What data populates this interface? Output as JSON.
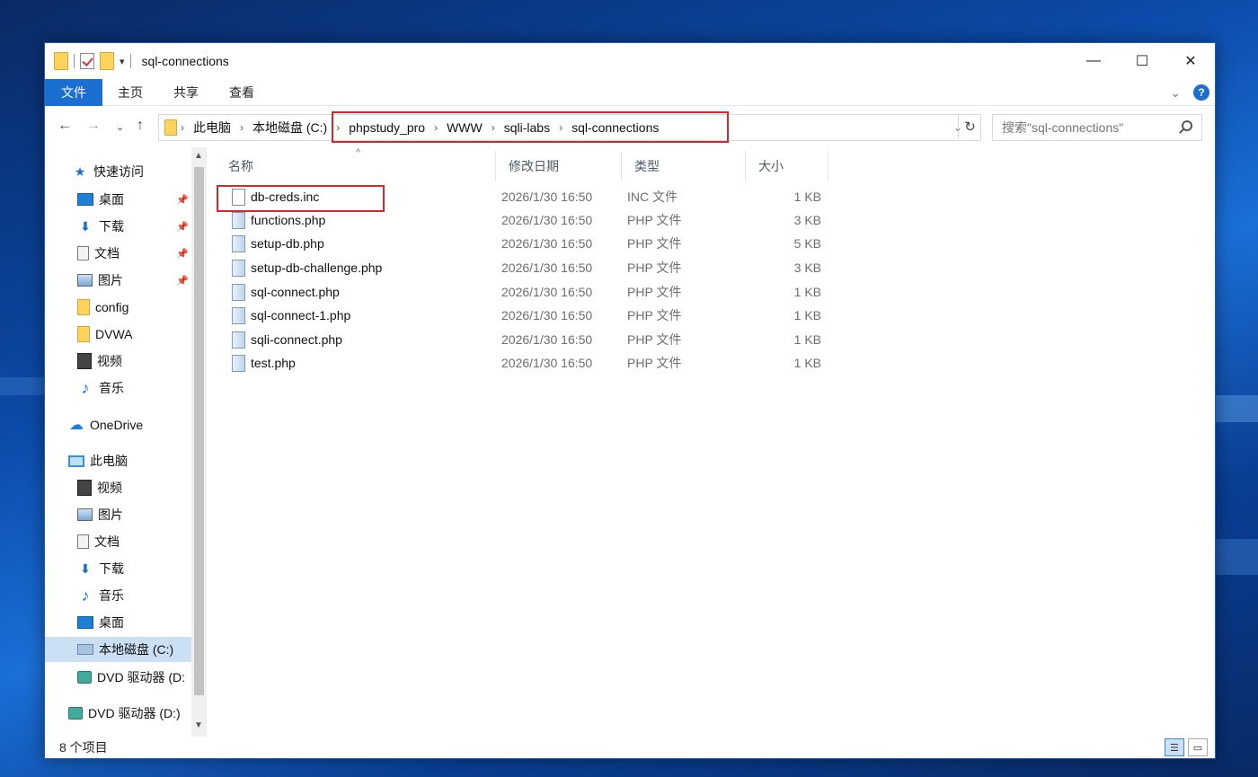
{
  "window": {
    "title": "sql-connections",
    "controls": {
      "minimize": "—",
      "maximize": "☐",
      "close": "✕"
    }
  },
  "ribbon": {
    "tabs": [
      {
        "label": "文件",
        "active": true
      },
      {
        "label": "主页"
      },
      {
        "label": "共享"
      },
      {
        "label": "查看"
      }
    ],
    "accent_color": "#1a6fd0"
  },
  "address": {
    "crumbs": [
      "此电脑",
      "本地磁盘 (C:)",
      "phpstudy_pro",
      "WWW",
      "sqli-labs",
      "sql-connections"
    ],
    "search_placeholder": "搜索\"sql-connections\""
  },
  "nav": {
    "quick_access": "快速访问",
    "items": [
      {
        "label": "桌面",
        "icon": "desktop-icon",
        "pinned": true
      },
      {
        "label": "下载",
        "icon": "download-icon",
        "pinned": true
      },
      {
        "label": "文档",
        "icon": "document-icon",
        "pinned": true
      },
      {
        "label": "图片",
        "icon": "picture-icon",
        "pinned": true
      },
      {
        "label": "config",
        "icon": "folder-icon"
      },
      {
        "label": "DVWA",
        "icon": "folder-icon"
      },
      {
        "label": "视频",
        "icon": "video-icon"
      },
      {
        "label": "音乐",
        "icon": "music-icon"
      },
      {
        "label": "OneDrive",
        "icon": "cloud-icon"
      },
      {
        "label": "此电脑",
        "icon": "computer-icon"
      },
      {
        "label": "视频",
        "icon": "video-icon"
      },
      {
        "label": "图片",
        "icon": "picture-icon"
      },
      {
        "label": "文档",
        "icon": "document-icon"
      },
      {
        "label": "下载",
        "icon": "download-icon"
      },
      {
        "label": "音乐",
        "icon": "music-icon"
      },
      {
        "label": "桌面",
        "icon": "desktop-icon"
      },
      {
        "label": "本地磁盘 (C:)",
        "icon": "disk-icon",
        "selected": true
      },
      {
        "label": "DVD 驱动器 (D:",
        "icon": "dvd-icon"
      },
      {
        "label": "DVD 驱动器 (D:)",
        "icon": "dvd-icon"
      }
    ]
  },
  "columns": {
    "name": "名称",
    "date": "修改日期",
    "type": "类型",
    "size": "大小"
  },
  "files": [
    {
      "name": "db-creds.inc",
      "date": "2026/1/30 16:50",
      "type": "INC 文件",
      "size": "1 KB",
      "highlighted": true
    },
    {
      "name": "functions.php",
      "date": "2026/1/30 16:50",
      "type": "PHP 文件",
      "size": "3 KB"
    },
    {
      "name": "setup-db.php",
      "date": "2026/1/30 16:50",
      "type": "PHP 文件",
      "size": "5 KB"
    },
    {
      "name": "setup-db-challenge.php",
      "date": "2026/1/30 16:50",
      "type": "PHP 文件",
      "size": "3 KB"
    },
    {
      "name": "sql-connect.php",
      "date": "2026/1/30 16:50",
      "type": "PHP 文件",
      "size": "1 KB"
    },
    {
      "name": "sql-connect-1.php",
      "date": "2026/1/30 16:50",
      "type": "PHP 文件",
      "size": "1 KB"
    },
    {
      "name": "sqli-connect.php",
      "date": "2026/1/30 16:50",
      "type": "PHP 文件",
      "size": "1 KB"
    },
    {
      "name": "test.php",
      "date": "2026/1/30 16:50",
      "type": "PHP 文件",
      "size": "1 KB"
    }
  ],
  "status": {
    "item_count": "8 个项目"
  },
  "highlight_color": "#d8262a"
}
